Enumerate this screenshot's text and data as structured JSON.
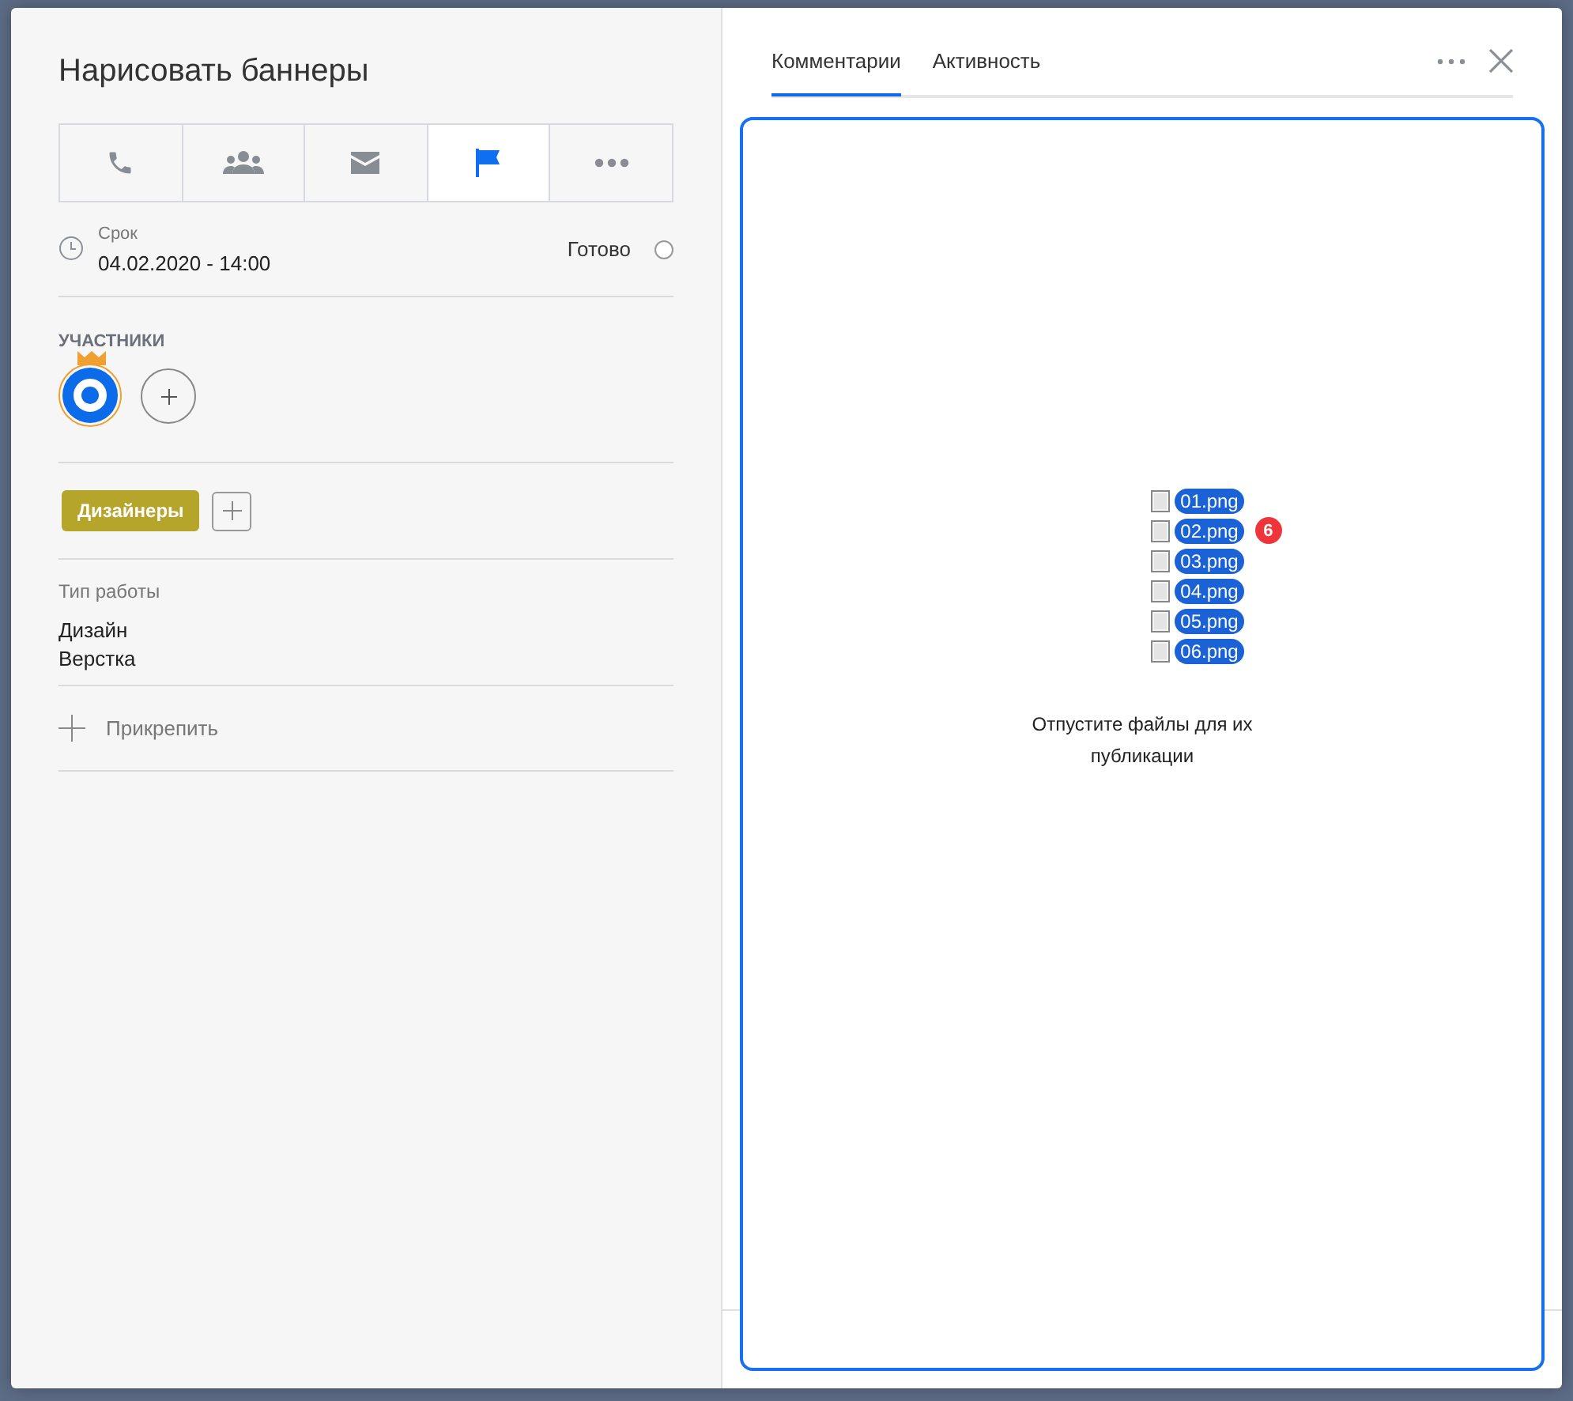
{
  "task": {
    "title": "Нарисовать баннеры"
  },
  "toolbar": [
    {
      "kind": "phone",
      "selected": false
    },
    {
      "kind": "group",
      "selected": false
    },
    {
      "kind": "mail",
      "selected": false
    },
    {
      "kind": "flag",
      "selected": true
    },
    {
      "kind": "more",
      "selected": false
    }
  ],
  "deadline": {
    "label": "Срок",
    "value": "04.02.2020 - 14:00"
  },
  "done": {
    "label": "Готово",
    "checked": false
  },
  "participants": {
    "heading": "УЧАСТНИКИ",
    "owner_crown": true
  },
  "tags": [
    {
      "label": "Дизайнеры",
      "color": "#b5a52a"
    }
  ],
  "work_type": {
    "label": "Тип работы",
    "values": [
      "Дизайн",
      "Верстка"
    ]
  },
  "attach": {
    "label": "Прикрепить"
  },
  "tabs": [
    {
      "label": "Комментарии",
      "selected": true
    },
    {
      "label": "Активность",
      "selected": false
    }
  ],
  "drop_zone": {
    "files": [
      "01.png",
      "02.png",
      "03.png",
      "04.png",
      "05.png",
      "06.png"
    ],
    "count": "6",
    "message": "Отпустите файлы для их публикации"
  }
}
